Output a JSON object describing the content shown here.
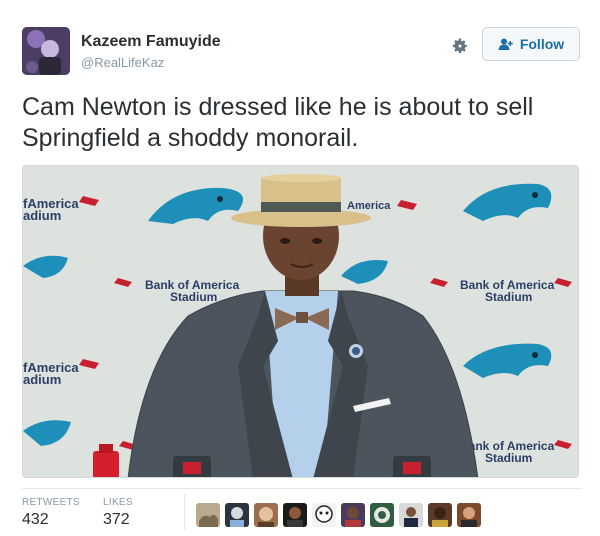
{
  "author": {
    "name": "Kazeem Famuyide",
    "handle": "@RealLifeKaz"
  },
  "follow_label": "Follow",
  "tweet_text": "Cam Newton is dressed like he is about to sell Springfield a shoddy monorail.",
  "media": {
    "backdrop_texts": [
      "fAmerica",
      "adium",
      "America",
      "ium",
      "Bank of America",
      "Stadium",
      "fAmerica",
      "adium",
      "Bank of America",
      "Stadium",
      "Bank of America",
      "Stadium"
    ]
  },
  "stats": {
    "retweets_label": "RETWEETS",
    "retweets_value": "432",
    "likes_label": "LIKES",
    "likes_value": "372"
  },
  "colors": {
    "accent": "#1b6fa6",
    "text": "#292f33",
    "muted": "#8899a6",
    "panther_blue": "#1d8fb8"
  },
  "likers": [
    "liker-avatar",
    "liker-avatar",
    "liker-avatar",
    "liker-avatar",
    "liker-avatar",
    "liker-avatar",
    "liker-avatar",
    "liker-avatar",
    "liker-avatar",
    "liker-avatar"
  ]
}
